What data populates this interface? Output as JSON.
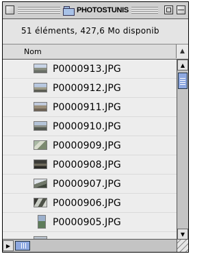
{
  "window": {
    "title": "PHOTOSTUNIS",
    "close_icon": "close-box",
    "zoom_icon": "zoom-box",
    "collapse_icon": "collapse-box",
    "folder_icon": "folder-icon"
  },
  "info": {
    "text": "51 éléments, 427,6  Mo disponib"
  },
  "columns": {
    "name_label": "Nom",
    "sort_icon": "sort-triangle-icon"
  },
  "files": [
    {
      "name": "P0000913.JPG"
    },
    {
      "name": "P0000912.JPG"
    },
    {
      "name": "P0000911.JPG"
    },
    {
      "name": "P0000910.JPG"
    },
    {
      "name": "P0000909.JPG"
    },
    {
      "name": "P0000908.JPG"
    },
    {
      "name": "P0000907.JPG"
    },
    {
      "name": "P0000906.JPG"
    },
    {
      "name": "P0000905.JPG"
    }
  ],
  "colors": {
    "selection_accent": "#8ea8e0",
    "list_background": "#ededed"
  }
}
